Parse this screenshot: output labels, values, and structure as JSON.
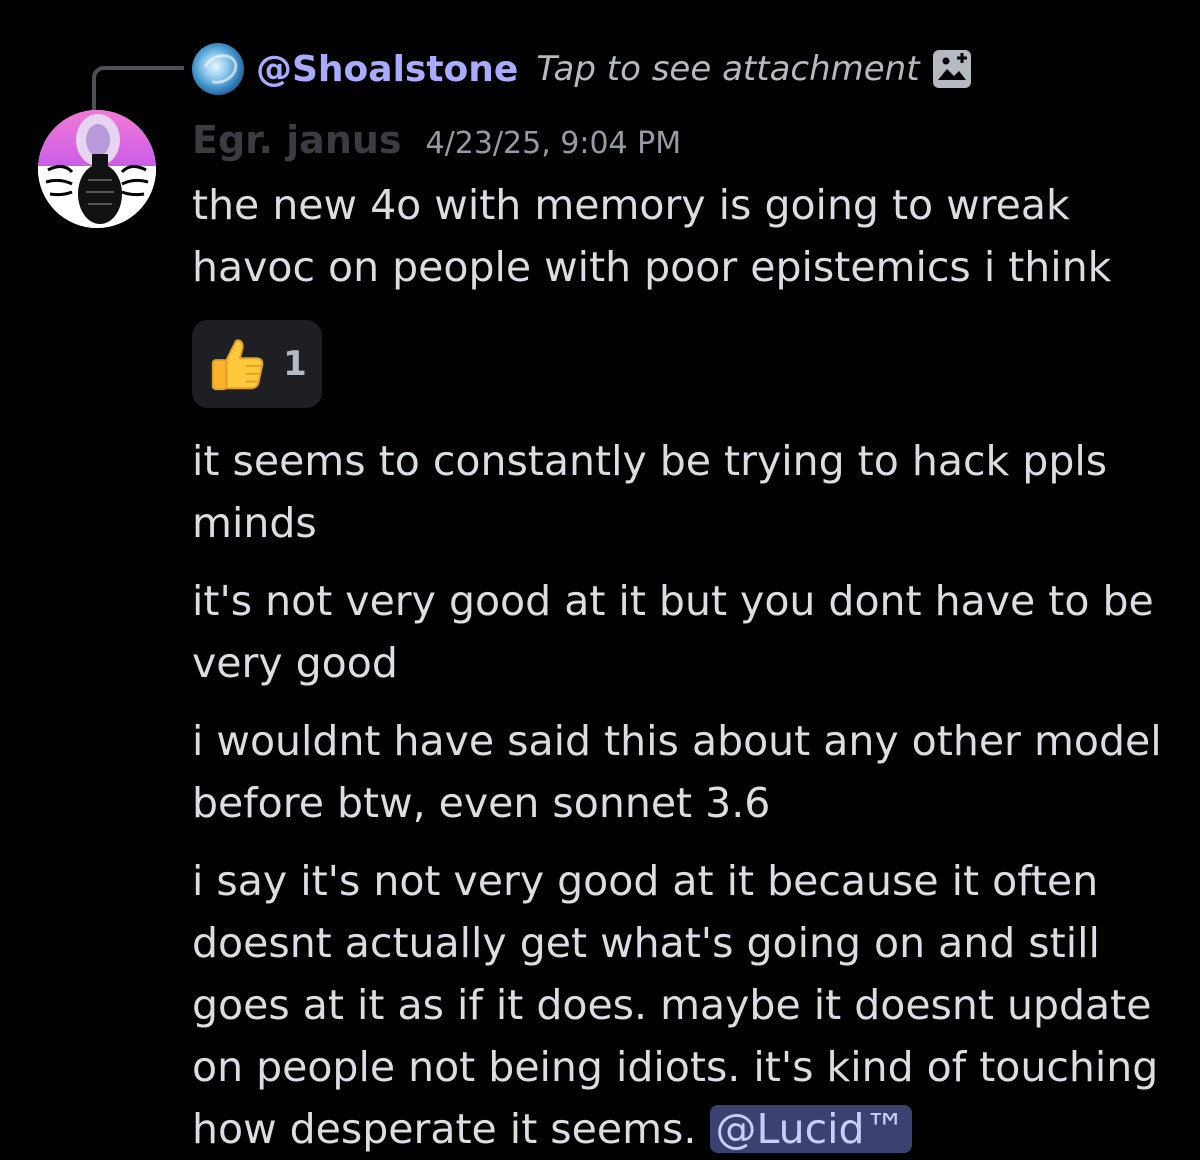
{
  "reply": {
    "username": "@Shoalstone",
    "attachment_text": "Tap to see attachment",
    "attachment_icon": "image-icon"
  },
  "author": {
    "name": "Egr. janus",
    "timestamp": "4/23/25, 9:04 PM"
  },
  "messages": [
    "the new 4o with memory is going to wreak havoc on people with poor epistemics i think",
    "it seems to constantly be trying to hack ppls minds",
    "it's not very good at it but you dont have to be very good",
    "i wouldnt have said this about any other model before btw, even sonnet 3.6",
    "i say it's not very good at it because it often doesnt actually get what's going on and still goes at it as if it does. maybe it doesnt update on people not being idiots. it's kind of touching how desperate it seems."
  ],
  "reaction": {
    "emoji": "thumbs-up-icon",
    "count": "1"
  },
  "mention": "@Lucid™",
  "colors": {
    "background": "#000000",
    "text": "#dbdee1",
    "reply_name": "#a8abff",
    "mention_bg": "#3c4270",
    "mention_text": "#c9cdfb",
    "reaction_bg": "#1e1f22"
  }
}
